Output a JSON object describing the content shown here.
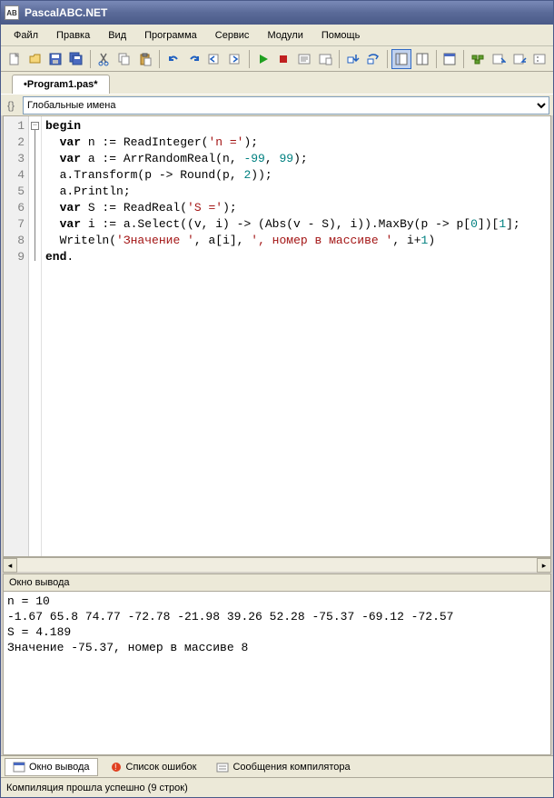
{
  "title": "PascalABC.NET",
  "menu": [
    "Файл",
    "Правка",
    "Вид",
    "Программа",
    "Сервис",
    "Модули",
    "Помощь"
  ],
  "tab": "•Program1.pas*",
  "navSelect": "Глобальные имена",
  "gutter": [
    "1",
    "2",
    "3",
    "4",
    "5",
    "6",
    "7",
    "8",
    "9"
  ],
  "code": {
    "l1": {
      "kw": "begin"
    },
    "l2": {
      "i": "  ",
      "kw": "var",
      "t1": " n := ReadInteger(",
      "s": "'n ='",
      "t2": ");"
    },
    "l3": {
      "i": "  ",
      "kw": "var",
      "t1": " a := ArrRandomReal(n, ",
      "n1": "-99",
      "t2": ", ",
      "n2": "99",
      "t3": ");"
    },
    "l4": {
      "i": "  ",
      "t1": "a.Transform(p -> Round(p, ",
      "n1": "2",
      "t2": "));"
    },
    "l5": {
      "i": "  ",
      "t1": "a.Println;"
    },
    "l6": {
      "i": "  ",
      "kw": "var",
      "t1": " S := ReadReal(",
      "s": "'S ='",
      "t2": ");"
    },
    "l7": {
      "i": "  ",
      "kw": "var",
      "t1": " i := a.Select((v, i) -> (Abs(v - S), i)).MaxBy(p -> p[",
      "n1": "0",
      "t2": "])[",
      "n2": "1",
      "t3": "];"
    },
    "l8": {
      "i": "  ",
      "t1": "Writeln(",
      "s1": "'Значение '",
      "t2": ", a[i], ",
      "s2": "', номер в массиве '",
      "t3": ", i+",
      "n1": "1",
      "t4": ")"
    },
    "l9": {
      "kw": "end",
      "t": "."
    }
  },
  "outputTitle": "Окно вывода",
  "output": "n = 10\n-1.67 65.8 74.77 -72.78 -21.98 39.26 52.28 -75.37 -69.12 -72.57\nS = 4.189\nЗначение -75.37, номер в массиве 8",
  "bottomTabs": [
    {
      "label": "Окно вывода",
      "active": true
    },
    {
      "label": "Список ошибок",
      "active": false
    },
    {
      "label": "Сообщения компилятора",
      "active": false
    }
  ],
  "status": "Компиляция прошла успешно (9 строк)"
}
